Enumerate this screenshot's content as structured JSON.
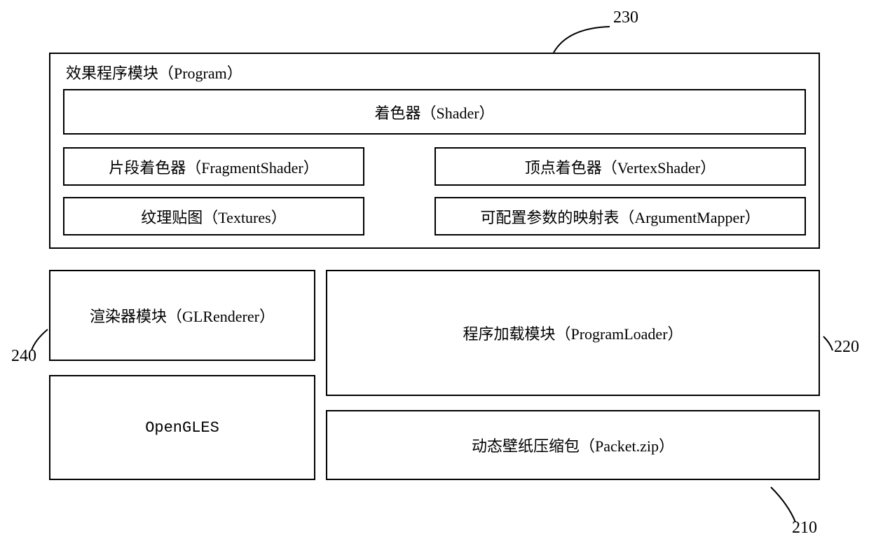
{
  "labels": {
    "ref230": "230",
    "ref220": "220",
    "ref240": "240",
    "ref210": "210"
  },
  "program": {
    "title": "效果程序模块（Program）",
    "shader": "着色器（Shader）",
    "fragment": "片段着色器（FragmentShader）",
    "vertex": "顶点着色器（VertexShader）",
    "textures": "纹理贴图（Textures）",
    "argmapper": "可配置参数的映射表（ArgumentMapper）"
  },
  "renderer": "渲染器模块（GLRenderer）",
  "opengles": "OpenGLES",
  "loader": "程序加载模块（ProgramLoader）",
  "packet": "动态壁纸压缩包（Packet.zip）"
}
